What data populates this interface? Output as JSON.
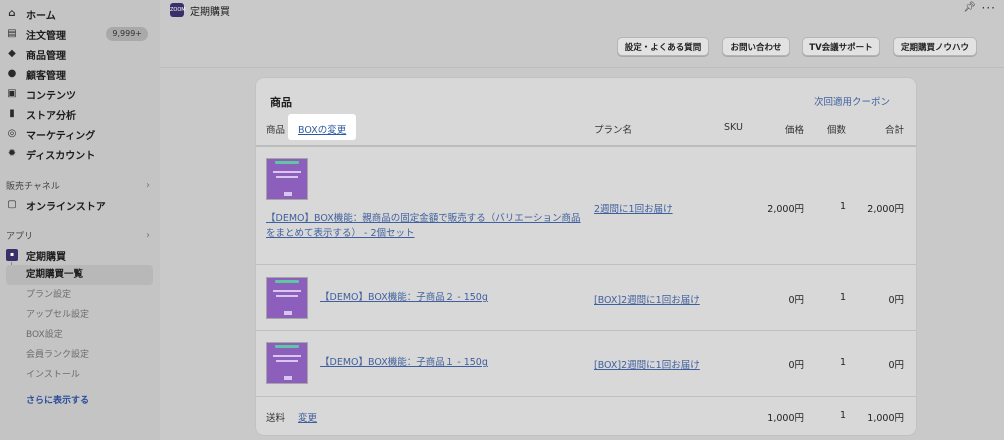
{
  "sidebar": {
    "main_items": [
      {
        "label": "ホーム",
        "icon": "home-icon"
      },
      {
        "label": "注文管理",
        "icon": "inbox-icon",
        "badge": "9,999+"
      },
      {
        "label": "商品管理",
        "icon": "tag-icon"
      },
      {
        "label": "顧客管理",
        "icon": "person-icon"
      },
      {
        "label": "コンテンツ",
        "icon": "content-icon"
      },
      {
        "label": "ストア分析",
        "icon": "bar-chart-icon"
      },
      {
        "label": "マーケティング",
        "icon": "target-icon"
      },
      {
        "label": "ディスカウント",
        "icon": "gear-discount-icon"
      }
    ],
    "sales_channel_heading": "販売チャネル",
    "online_store": "オンラインストア",
    "apps_heading": "アプリ",
    "app_name": "定期購買",
    "sub_items": [
      "定期購買一覧",
      "プラン設定",
      "アップセル設定",
      "BOX設定",
      "会員ランク設定",
      "インストール"
    ],
    "show_more": "さらに表示する"
  },
  "topbar": {
    "logo_text": "ZOOM",
    "title": "定期購買"
  },
  "toolbar": {
    "buttons": [
      "設定・よくある質問",
      "お問い合わせ",
      "TV会議サポート",
      "定期購買ノウハウ"
    ]
  },
  "card": {
    "title": "商品",
    "coupon_link": "次回適用クーポン",
    "headers": {
      "product": "商品",
      "box_change": "BOXの変更",
      "plan": "プラン名",
      "sku": "SKU",
      "price": "価格",
      "qty": "個数",
      "total": "合計"
    },
    "rows": [
      {
        "name": "【DEMO】BOX機能：親商品の固定金額で販売する（バリエーション商品をまとめて表示する） - 2個セット",
        "plan": "2週間に1回お届け",
        "price": "2,000円",
        "qty": "1",
        "total": "2,000円"
      },
      {
        "name": "【DEMO】BOX機能：子商品２ - 150g",
        "plan": "[BOX]2週間に1回お届け",
        "price": "0円",
        "qty": "1",
        "total": "0円"
      },
      {
        "name": "【DEMO】BOX機能：子商品１ - 150g",
        "plan": "[BOX]2週間に1回お届け",
        "price": "0円",
        "qty": "1",
        "total": "0円"
      }
    ],
    "shipping": {
      "label": "送料",
      "change": "変更",
      "price": "1,000円",
      "qty": "1",
      "total": "1,000円"
    }
  }
}
